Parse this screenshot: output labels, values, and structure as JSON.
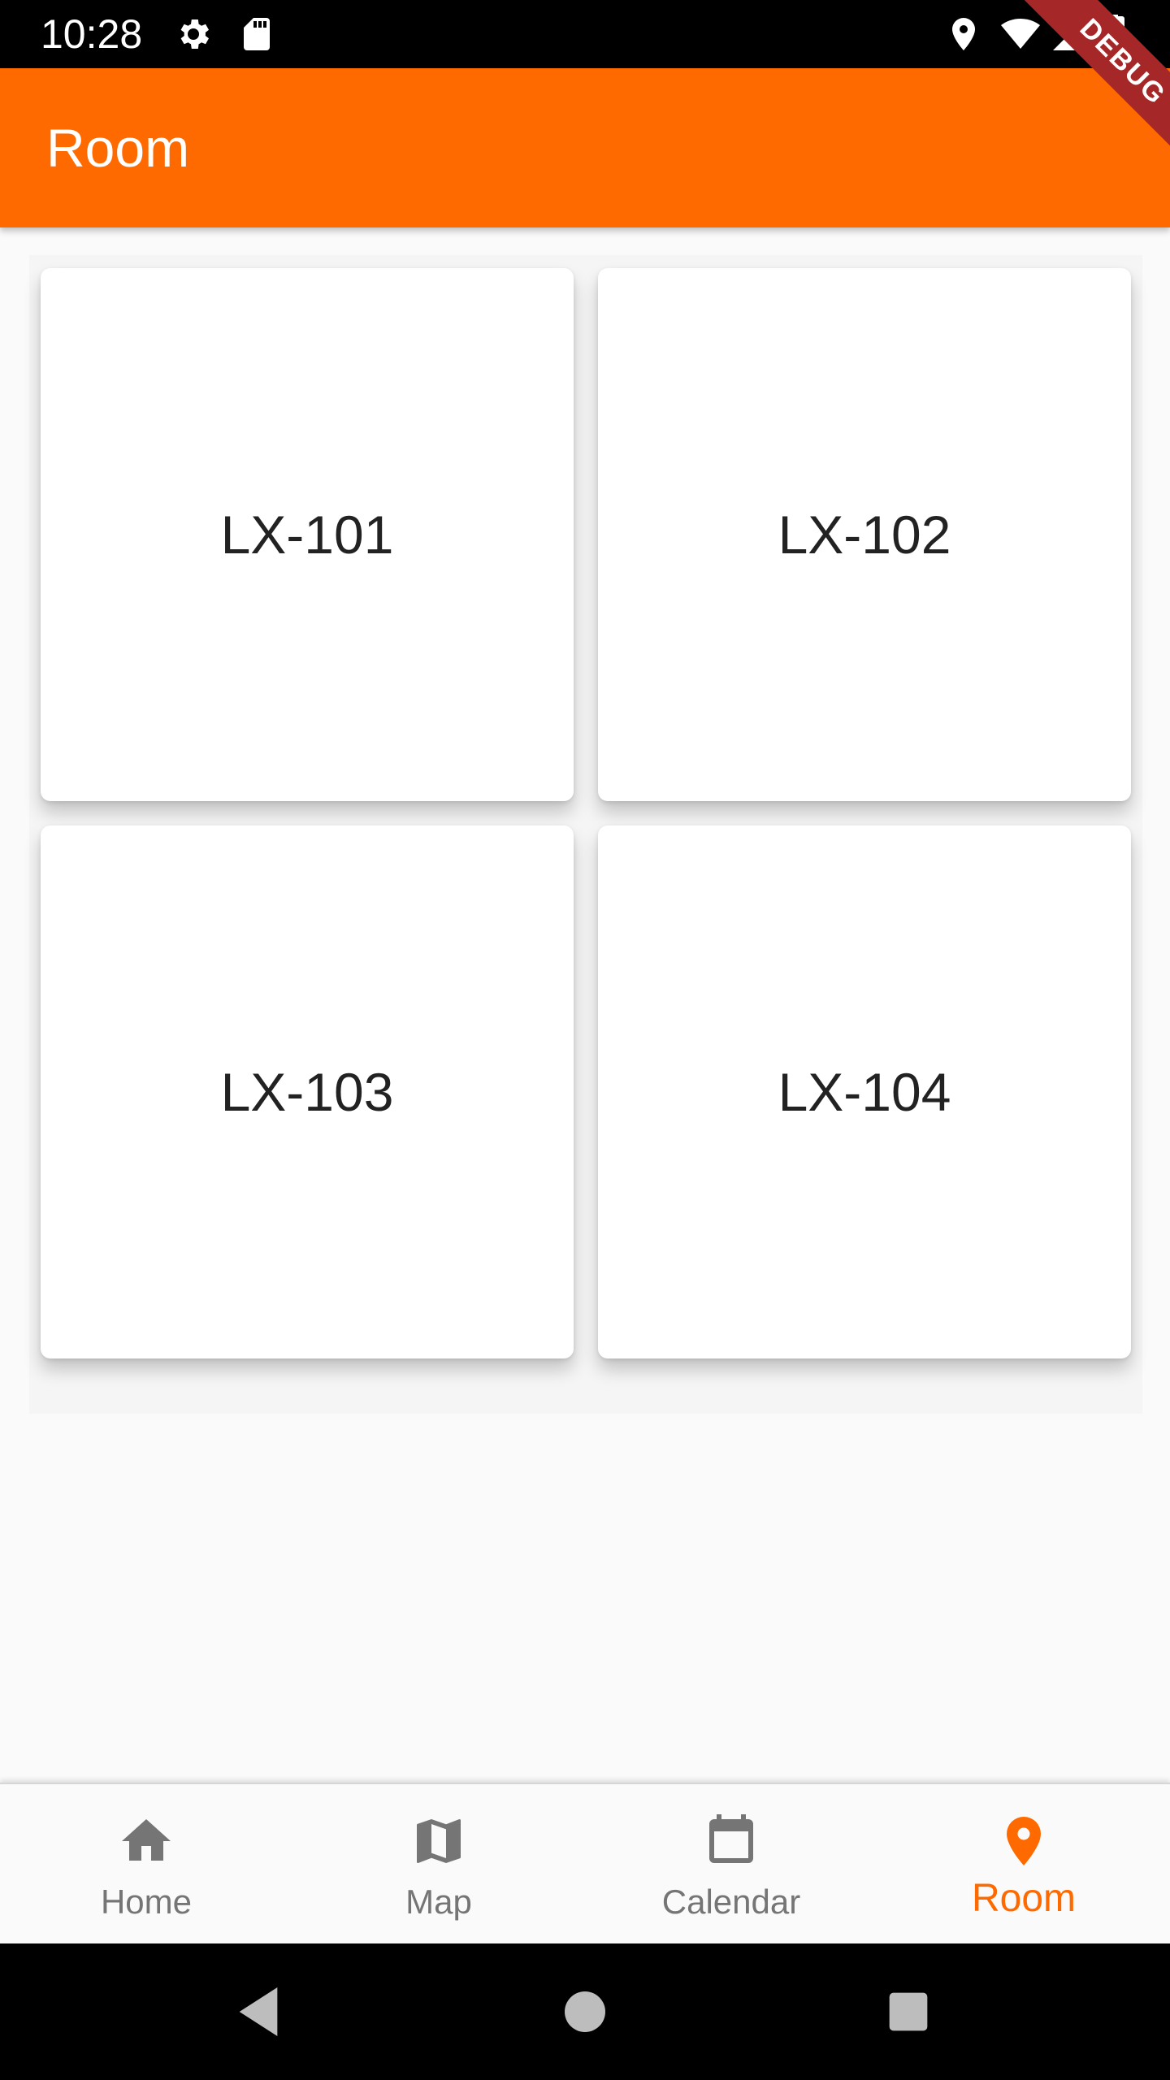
{
  "status_bar": {
    "time": "10:28",
    "left_icons": [
      "settings-gear-icon",
      "sd-card-icon"
    ],
    "right_icons": [
      "location-icon",
      "wifi-icon",
      "signal-icon",
      "battery-icon"
    ]
  },
  "debug_banner": {
    "label": "DEBUG"
  },
  "app_bar": {
    "title": "Room",
    "color": "#ff6a00"
  },
  "rooms": [
    {
      "label": "LX-101"
    },
    {
      "label": "LX-102"
    },
    {
      "label": "LX-103"
    },
    {
      "label": "LX-104"
    }
  ],
  "bottom_nav": {
    "items": [
      {
        "label": "Home",
        "icon": "home-icon"
      },
      {
        "label": "Map",
        "icon": "map-icon"
      },
      {
        "label": "Calendar",
        "icon": "calendar-icon"
      },
      {
        "label": "Room",
        "icon": "location-pin-icon"
      }
    ],
    "active": "Room",
    "active_color": "#ff6a00",
    "inactive_color": "#757575"
  },
  "system_nav": {
    "buttons": [
      "back-icon",
      "home-circle-icon",
      "recents-icon"
    ]
  }
}
